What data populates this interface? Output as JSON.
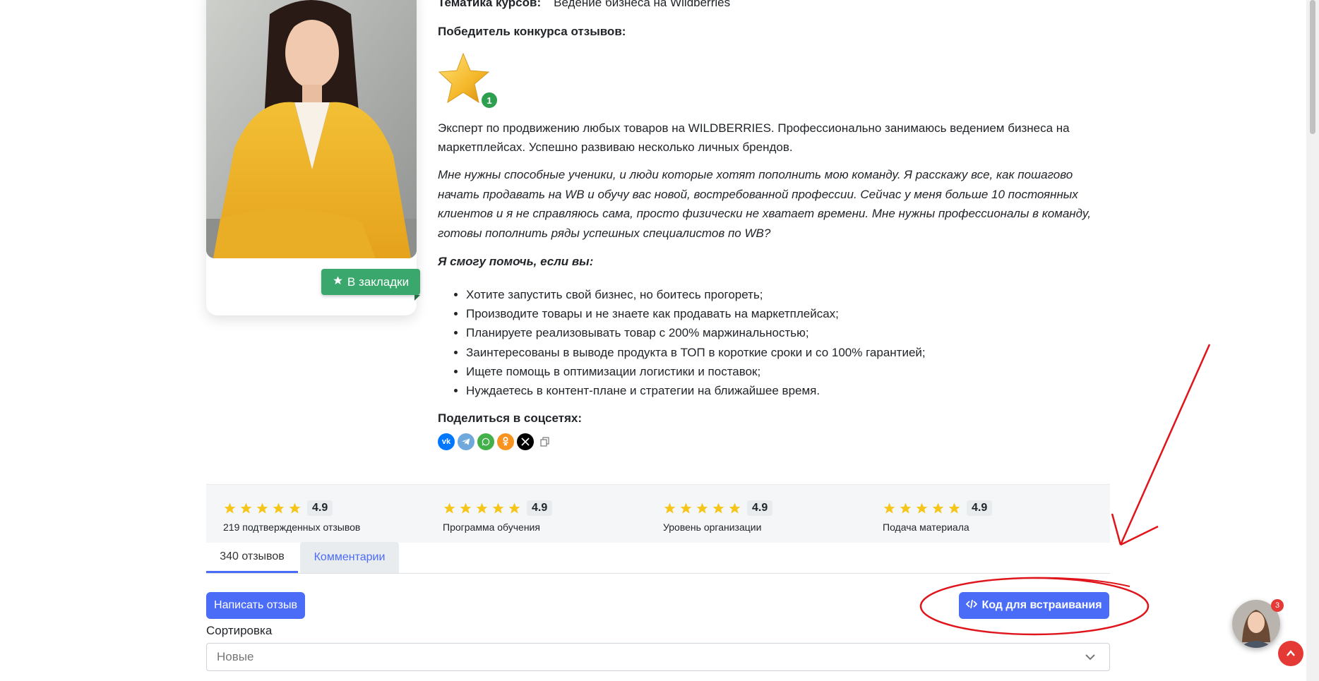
{
  "course": {
    "topic_label": "Тематика курсов:",
    "topic_value": "Ведение бизнеса на Wildberries",
    "winner_label": "Победитель конкурса отзывов:",
    "badge_count": "1"
  },
  "bookmark": {
    "label": "В закладки",
    "icon": "star-icon"
  },
  "about": {
    "paragraph1": "Эксперт по продвижению любых товаров на WILDBERRIES. Профессионально занимаюсь ведением бизнеса на маркетплейсах. Успешно развиваю несколько личных брендов.",
    "paragraph2": "Мне нужны способные ученики, и люди которые хотят пополнить мою команду. Я расскажу все, как пошагово начать продавать на WB и обучу вас новой, востребованной профессии. Сейчас у меня больше 10 постоянных клиентов и я не справляюсь сама, просто физически не хватает времени. Мне нужны профессионалы в команду, готовы пополнить ряды успешных специалистов по WB?",
    "help_heading": "Я смогу помочь, если вы:",
    "help_items": [
      "Хотите запустить свой бизнес, но боитесь прогореть;",
      "Производите товары и не знаете как продавать на маркетплейсах;",
      "Планируете реализовывать товар с 200% маржинальностью;",
      "Заинтересованы в выводе продукта в ТОП в короткие сроки и со 100% гарантией;",
      "Ищете помощь в оптимизации логистики и поставок;",
      "Нуждаетесь в контент-плане и стратегии на ближайшее время."
    ]
  },
  "share": {
    "label": "Поделиться в соцсетях:",
    "icons": [
      "vk-icon",
      "telegram-icon",
      "whatsapp-icon",
      "odnoklassniki-icon",
      "x-icon",
      "copy-icon"
    ],
    "colors": {
      "vk": "#0077ff",
      "telegram": "#6fa8dc",
      "whatsapp": "#43b04a",
      "ok": "#f7931e",
      "x": "#000000"
    }
  },
  "ratings": [
    {
      "score": "4.9",
      "label": "219 подтвержденных отзывов",
      "stars": 5
    },
    {
      "score": "4.9",
      "label": "Программа обучения",
      "stars": 5
    },
    {
      "score": "4.9",
      "label": "Уровень организации",
      "stars": 5
    },
    {
      "score": "4.9",
      "label": "Подача материала",
      "stars": 5
    }
  ],
  "tabs": {
    "reviews": "340 отзывов",
    "comments": "Комментарии"
  },
  "actions": {
    "write_review": "Написать отзыв",
    "embed_code": "Код для встраивания"
  },
  "sort": {
    "label": "Сортировка",
    "value": "Новые"
  },
  "chat": {
    "badge": "3"
  },
  "colors": {
    "primary": "#4a6cf7",
    "bookmark_green": "#3aa76d",
    "star_yellow": "#f5c518",
    "annotation_red": "#e0141b"
  }
}
